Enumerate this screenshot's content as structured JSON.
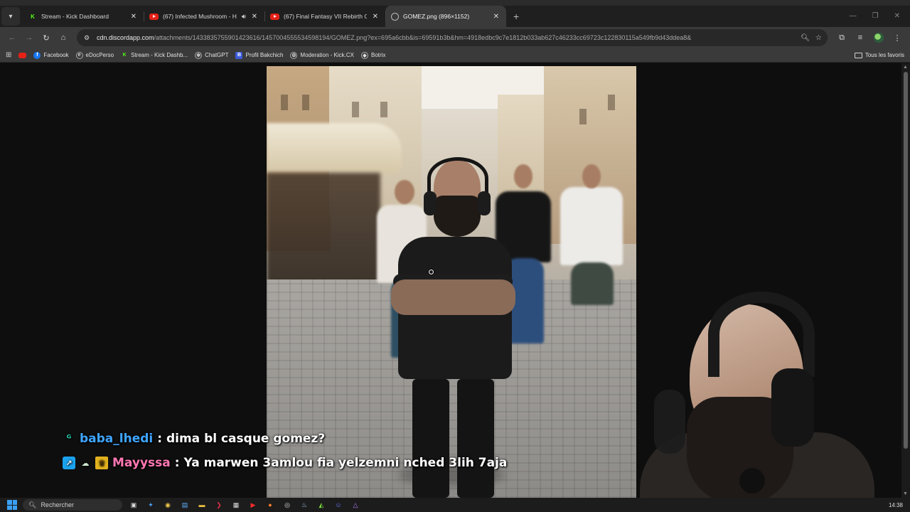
{
  "tabs": [
    {
      "title": "Stream - Kick Dashboard",
      "icon": "kick-icon",
      "active": false
    },
    {
      "title": "(67) Infected Mushroom - H",
      "icon": "youtube-icon",
      "active": false,
      "audio": true
    },
    {
      "title": "(67) Final Fantasy VII Rebirth O",
      "icon": "youtube-icon",
      "active": false
    },
    {
      "title": "GOMEZ.png (896×1152)",
      "icon": "image-icon",
      "active": true
    }
  ],
  "address": {
    "host": "cdn.discordapp.com",
    "path": "/attachments/1433835755901423616/1457004555534598194/GOMEZ.png?ex=695a6cbb&is=69591b3b&hm=4918edbc9c7e1812b033ab627c46233cc69723c122830115a549fb9d43ddea8&"
  },
  "bookmarks": [
    {
      "label": "",
      "icon": "youtube-icon"
    },
    {
      "label": "Facebook",
      "icon": "facebook-icon"
    },
    {
      "label": "eDocPerso",
      "icon": "edoc-icon"
    },
    {
      "label": "Stream - Kick Dashb...",
      "icon": "kick-icon"
    },
    {
      "label": "ChatGPT",
      "icon": "chatgpt-icon"
    },
    {
      "label": "Profil Bakchich",
      "icon": "bakchich-icon"
    },
    {
      "label": "Moderation - Kick.CX",
      "icon": "moderation-icon"
    },
    {
      "label": "Botrix",
      "icon": "botrix-icon"
    }
  ],
  "bookmarks_right": "Tous les favoris",
  "chat": [
    {
      "user": "baba_lhedi",
      "message": ": dima bl casque gomez?",
      "user_color": "#3fa5ff"
    },
    {
      "user": "Mayyssa",
      "message": ": Ya marwen 3amlou fia yelzemni nched 3lih 7aja",
      "user_color": "#ff77b3"
    }
  ],
  "taskbar": {
    "search_placeholder": "Rechercher",
    "time": "14:38"
  },
  "colors": {
    "accent_kick": "#53fc18",
    "chrome_bg": "#3a3a3a"
  }
}
